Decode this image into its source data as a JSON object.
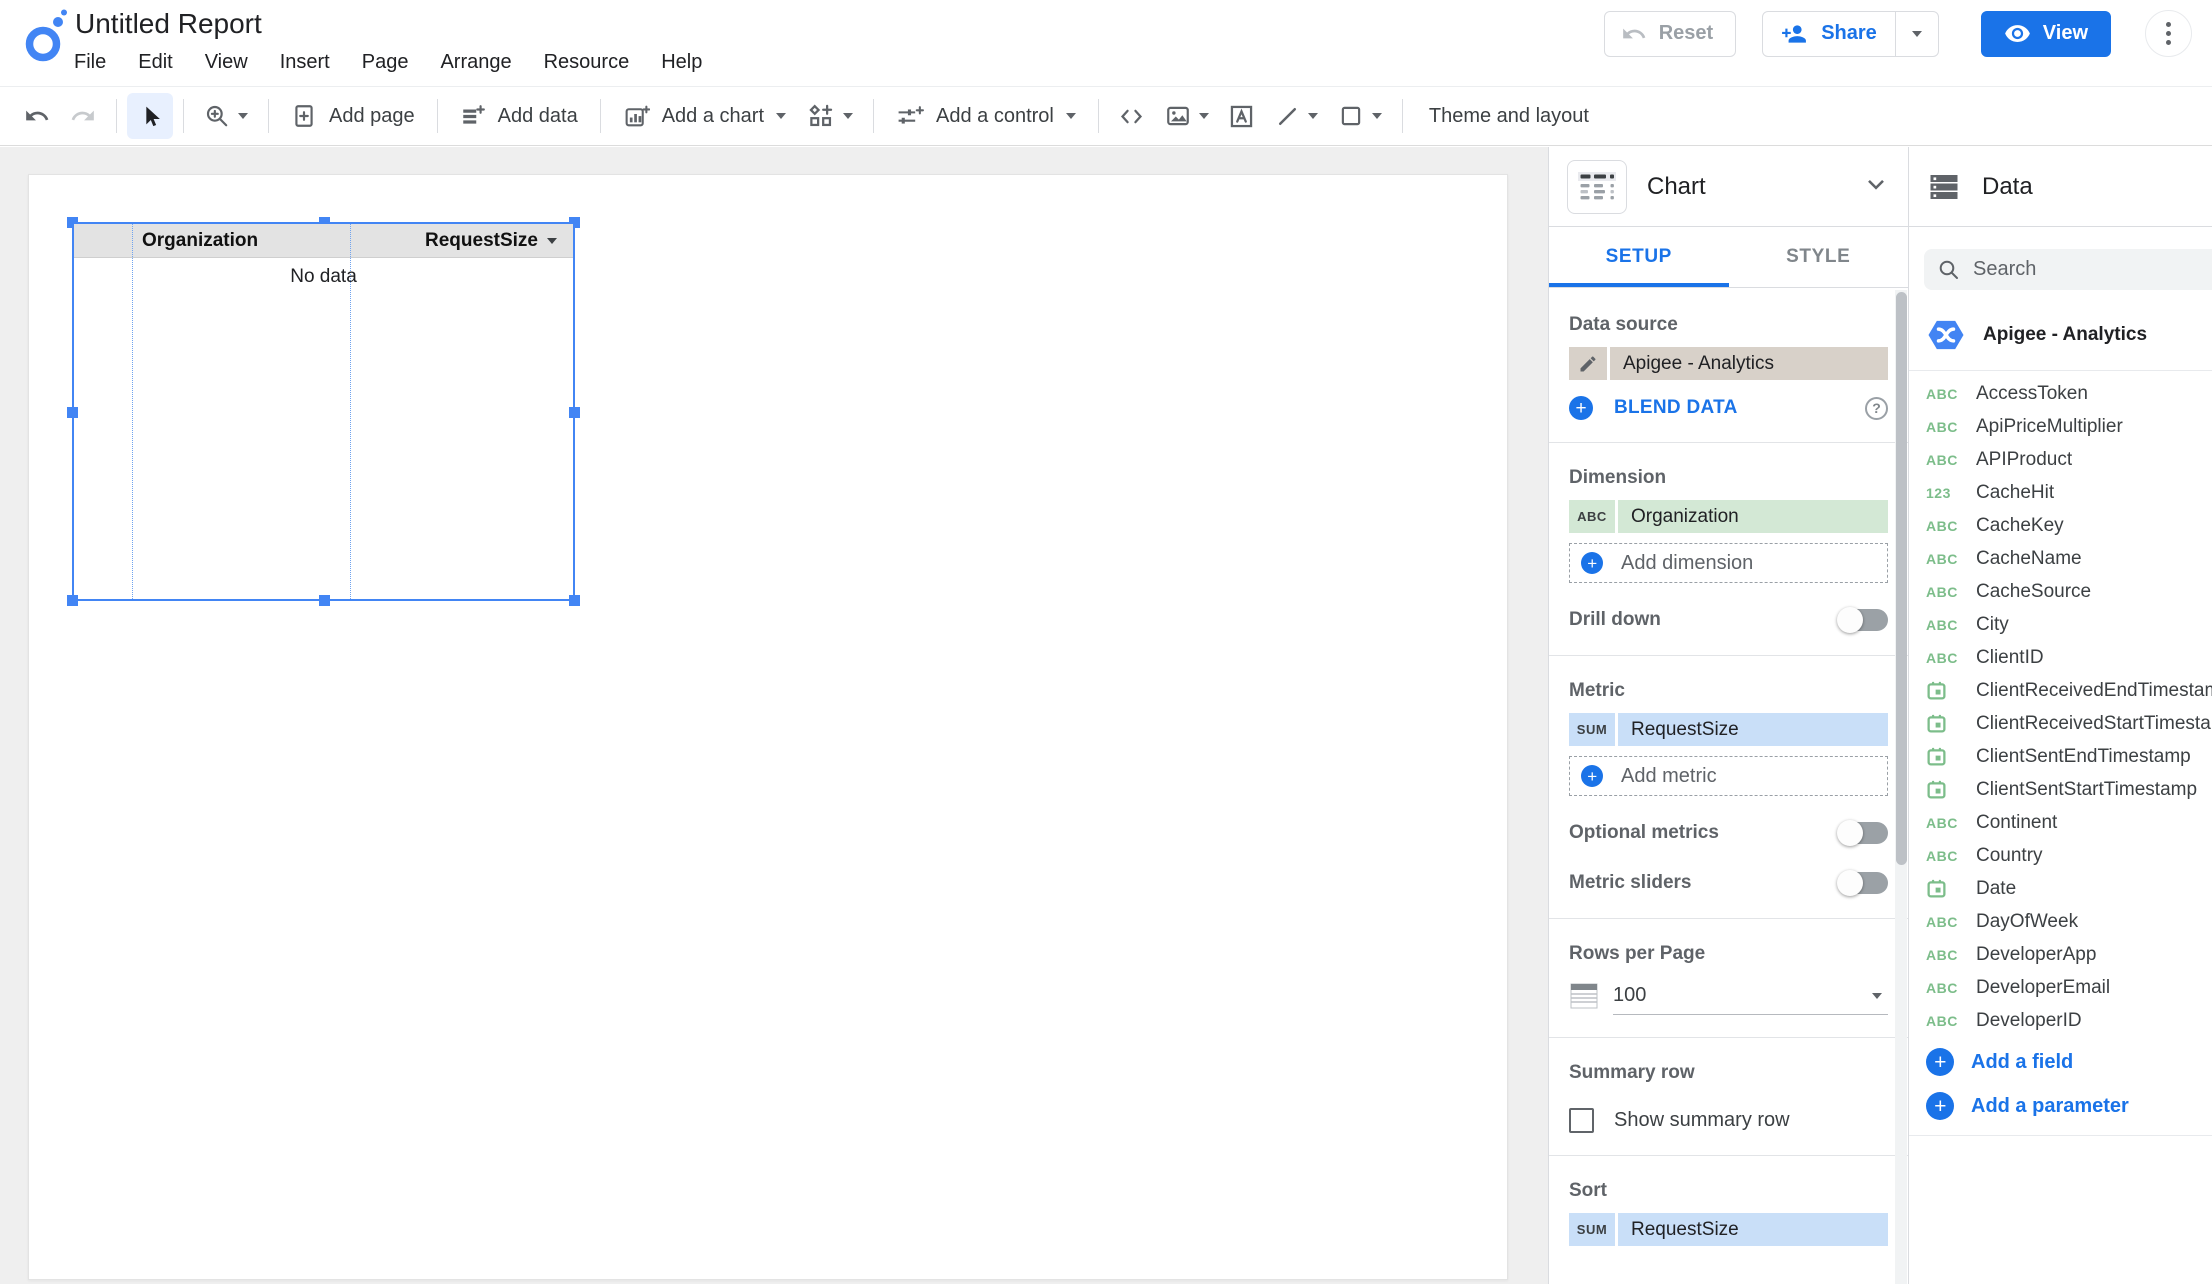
{
  "header": {
    "title": "Untitled Report",
    "menus": [
      "File",
      "Edit",
      "View",
      "Insert",
      "Page",
      "Arrange",
      "Resource",
      "Help"
    ],
    "buttons": {
      "reset": "Reset",
      "share": "Share",
      "view": "View"
    }
  },
  "toolbar": {
    "add_page": "Add page",
    "add_data": "Add data",
    "add_chart": "Add a chart",
    "add_control": "Add a control",
    "theme_layout": "Theme and layout"
  },
  "canvas": {
    "table": {
      "columns": [
        "Organization",
        "RequestSize"
      ],
      "empty_text": "No data"
    }
  },
  "setup_panel": {
    "header": "Chart",
    "tabs": {
      "setup": "SETUP",
      "style": "STYLE"
    },
    "data_source": {
      "label": "Data source",
      "value": "Apigee - Analytics",
      "blend": "BLEND DATA"
    },
    "dimension": {
      "label": "Dimension",
      "badge": "ABC",
      "value": "Organization",
      "add": "Add dimension"
    },
    "drill_down": {
      "label": "Drill down",
      "enabled": false
    },
    "metric": {
      "label": "Metric",
      "badge": "SUM",
      "value": "RequestSize",
      "add": "Add metric"
    },
    "optional_metrics": {
      "label": "Optional metrics",
      "enabled": false
    },
    "metric_sliders": {
      "label": "Metric sliders",
      "enabled": false
    },
    "rows_per_page": {
      "label": "Rows per Page",
      "value": "100"
    },
    "summary_row": {
      "label": "Summary row",
      "checkbox_label": "Show summary row",
      "checked": false
    },
    "sort": {
      "label": "Sort",
      "badge": "SUM",
      "value": "RequestSize"
    }
  },
  "data_panel": {
    "title": "Data",
    "search_placeholder": "Search",
    "source": "Apigee - Analytics",
    "fields": [
      {
        "type": "text",
        "name": "AccessToken"
      },
      {
        "type": "text",
        "name": "ApiPriceMultiplier"
      },
      {
        "type": "text",
        "name": "APIProduct"
      },
      {
        "type": "number",
        "name": "CacheHit"
      },
      {
        "type": "text",
        "name": "CacheKey"
      },
      {
        "type": "text",
        "name": "CacheName"
      },
      {
        "type": "text",
        "name": "CacheSource"
      },
      {
        "type": "text",
        "name": "City"
      },
      {
        "type": "text",
        "name": "ClientID"
      },
      {
        "type": "date",
        "name": "ClientReceivedEndTimestamp"
      },
      {
        "type": "date",
        "name": "ClientReceivedStartTimestamp"
      },
      {
        "type": "date",
        "name": "ClientSentEndTimestamp"
      },
      {
        "type": "date",
        "name": "ClientSentStartTimestamp"
      },
      {
        "type": "text",
        "name": "Continent"
      },
      {
        "type": "text",
        "name": "Country"
      },
      {
        "type": "date",
        "name": "Date"
      },
      {
        "type": "text",
        "name": "DayOfWeek"
      },
      {
        "type": "text",
        "name": "DeveloperApp"
      },
      {
        "type": "text",
        "name": "DeveloperEmail"
      },
      {
        "type": "text",
        "name": "DeveloperID"
      }
    ],
    "add_field": "Add a field",
    "add_parameter": "Add a parameter"
  },
  "colors": {
    "accent_blue": "#1a73e8",
    "selection_blue": "#4285f4",
    "dimension_green": "#d3e8d5",
    "metric_blue": "#c9dff8",
    "datasource_tan": "#d8d1c9",
    "field_type_green": "#7cbd8a",
    "toolbar_highlight": "#e8f0fe"
  }
}
